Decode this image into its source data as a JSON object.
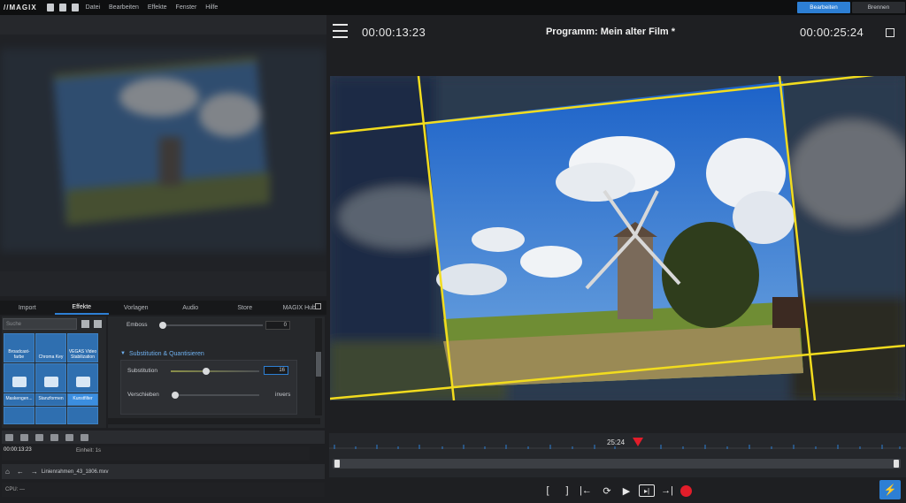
{
  "menubar": {
    "logo": "//MAGIX",
    "menus": [
      "Datei",
      "Bearbeiten",
      "Effekte",
      "Fenster",
      "Hilfe"
    ],
    "mode_buttons": [
      "Bearbeiten",
      "Brennen"
    ]
  },
  "left_panel": {
    "tabs": [
      "Import",
      "Effekte",
      "Vorlagen",
      "Audio",
      "Store",
      "MAGIX Hub"
    ],
    "active_tab": "Effekte",
    "search_placeholder": "Suche",
    "tiles": [
      {
        "label": "Broadcast-\nfarbe"
      },
      {
        "label": "Chroma Key"
      },
      {
        "label": "VEGAS Video\nStabilization"
      },
      {
        "label": ""
      },
      {
        "label": ""
      },
      {
        "label": ""
      },
      {
        "label": "Maskengen..."
      },
      {
        "label": "Stanzformen"
      },
      {
        "label": "Kunstfilter"
      }
    ],
    "params": {
      "emboss_label": "Emboss",
      "emboss_value": "0",
      "section_title": "Substitution & Quantisieren",
      "substitution_label": "Substitution",
      "substitution_value": "16",
      "verschieben_label": "Verschieben",
      "invers_label": "invers"
    },
    "timeline": {
      "timecode": "00:00:13:23",
      "einheit": "Einheit:  1s"
    },
    "file_name": "Linienrahmen_43_1806.mxv",
    "cpu_label": "CPU:  —"
  },
  "program": {
    "timecode_left": "00:00:13:23",
    "title": "Programm: Mein alter Film *",
    "timecode_right": "00:00:25:24",
    "playhead_label": "25:24",
    "colors": {
      "frame_lines": "#f2dc1e",
      "accent": "#2d7fd4",
      "record": "#e21d2a"
    }
  },
  "transport": {
    "mark_in": "[",
    "mark_out": "]",
    "icons": [
      "to-start-icon",
      "loop-icon",
      "play-icon",
      "next-marker-icon",
      "to-end-icon",
      "record-icon",
      "lightning-icon"
    ]
  }
}
